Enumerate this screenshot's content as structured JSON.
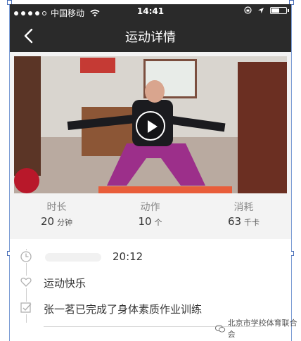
{
  "status_bar": {
    "carrier": "中国移动",
    "time": "14:41",
    "signal_dots": 5,
    "battery_level": 0.55
  },
  "nav": {
    "title": "运动详情",
    "back_icon": "chevron-left-icon"
  },
  "video": {
    "play_icon": "play-icon"
  },
  "stats": [
    {
      "label": "时长",
      "value": "20",
      "unit": "分钟"
    },
    {
      "label": "动作",
      "value": "10",
      "unit": "个"
    },
    {
      "label": "消耗",
      "value": "63",
      "unit": "千卡"
    }
  ],
  "details": {
    "time": "20:12",
    "mood": "运动快乐",
    "completion": "张一茗已完成了身体素质作业训练"
  },
  "watermark": {
    "text": "北京市学校体育联合会"
  },
  "colors": {
    "header_bg": "#2a2a2a",
    "content_bg": "#f3f3f3",
    "label_gray": "#8a8a8a"
  }
}
